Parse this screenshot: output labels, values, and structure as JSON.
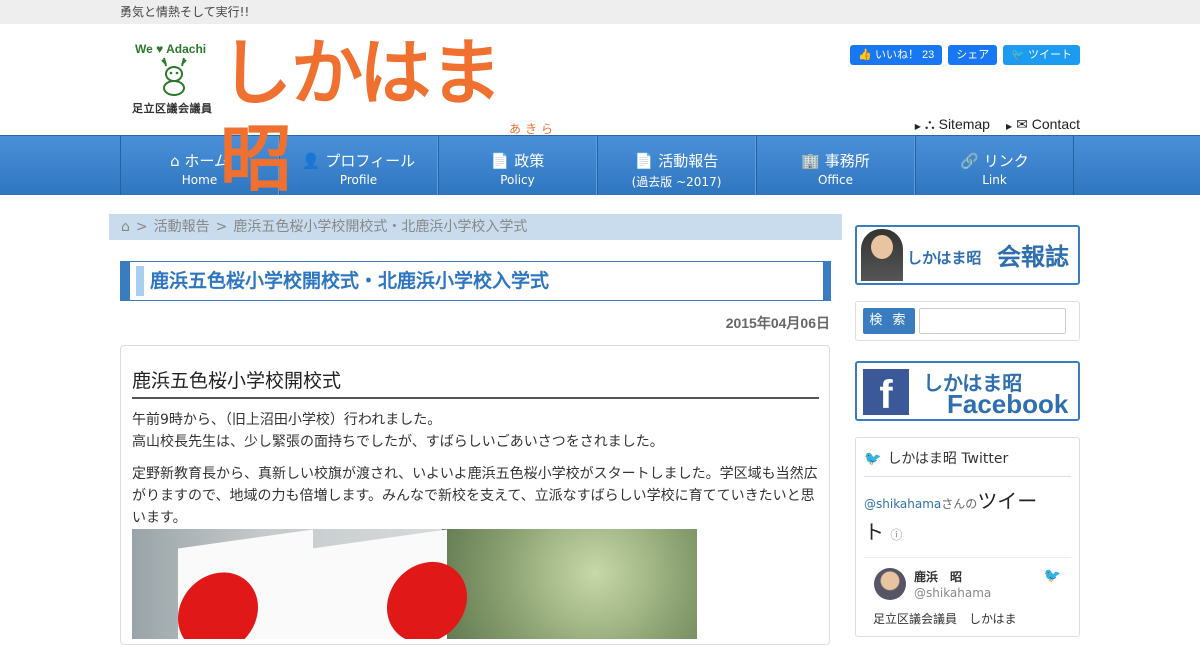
{
  "tagline": "勇気と情熱そして実行!!",
  "logo": {
    "we": "We ♥ Adachi",
    "assembly": "足立区議会議員",
    "name": "しかはま昭",
    "ruby": "あきら"
  },
  "social": {
    "like": "👍 いいね！ 23",
    "share": "シェア",
    "tweet": "ツイート"
  },
  "util": {
    "sitemap": "Sitemap",
    "contact": "Contact"
  },
  "nav": [
    {
      "jp": "⌂ ホーム",
      "en": "Home"
    },
    {
      "jp": "👤 プロフィール",
      "en": "Profile"
    },
    {
      "jp": "📄 政策",
      "en": "Policy"
    },
    {
      "jp": "📄 活動報告",
      "en": "(過去版 ~2017)"
    },
    {
      "jp": "🏢 事務所",
      "en": "Office"
    },
    {
      "jp": "🔗 リンク",
      "en": "Link"
    }
  ],
  "breadcrumb": {
    "home_icon": "⌂",
    "sep": ">",
    "cat": "活動報告",
    "current": "鹿浜五色桜小学校開校式・北鹿浜小学校入学式"
  },
  "page_title": "鹿浜五色桜小学校開校式・北鹿浜小学校入学式",
  "date": "2015年04月06日",
  "article": {
    "heading": "鹿浜五色桜小学校開校式",
    "p1_line1": "午前9時から、（旧上沼田小学校）行われました。",
    "p1_line2": "高山校長先生は、少し緊張の面持ちでしたが、すばらしいごあいさつをされました。",
    "p2": "定野新教育長から、真新しい校旗が渡され、いよいよ鹿浜五色桜小学校がスタートしました。学区域も当然広がりますので、地域の力も倍増します。みんなで新校を支えて、立派なすばらしい学校に育てていきたいと思います。"
  },
  "sidebar": {
    "kaiho_name": "しかはま昭",
    "kaiho_label": "会報誌",
    "search_btn": "検 索",
    "fb_name": "しかはま昭",
    "fb_label": "Facebook",
    "twitter_head": "しかはま昭 Twitter",
    "tl_handle": "@shikahama",
    "tl_san": "さんの",
    "tl_word": "ツイート",
    "tw_name": "鹿浜　昭",
    "tw_handle": "@shikahama",
    "tw_bio": "足立区議会議員　しかはま"
  }
}
